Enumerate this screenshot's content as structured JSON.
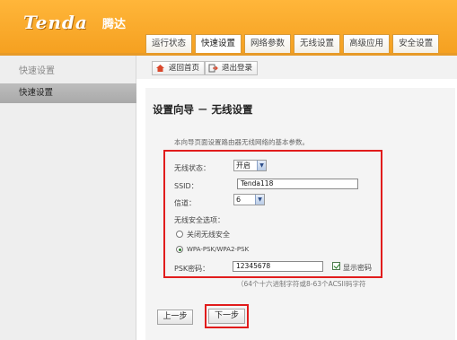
{
  "brand": {
    "logo": "Tenda",
    "logo_cn": "腾达"
  },
  "tabs": [
    {
      "label": "运行状态",
      "active": false
    },
    {
      "label": "快速设置",
      "active": true
    },
    {
      "label": "网络参数",
      "active": false
    },
    {
      "label": "无线设置",
      "active": false
    },
    {
      "label": "高级应用",
      "active": false
    },
    {
      "label": "安全设置",
      "active": false
    }
  ],
  "sidebar": {
    "title": "快速设置",
    "items": [
      {
        "label": "快速设置",
        "selected": true
      }
    ]
  },
  "toolbar": {
    "home_label": "返回首页",
    "logout_label": "退出登录"
  },
  "page": {
    "title": "设置向导 － 无线设置",
    "description": "本向导页面设置路由器无线网络的基本参数。"
  },
  "form": {
    "wireless_status_label": "无线状态：",
    "wireless_status_value": "开启",
    "ssid_label": "SSID：",
    "ssid_value": "Tenda118",
    "channel_label": "信道：",
    "channel_value": "6",
    "security_label": "无线安全选项：",
    "security_off_label": "关闭无线安全",
    "security_wpa_label": "WPA-PSK/WPA2-PSK",
    "psk_label": "PSK密码：",
    "psk_value": "12345678",
    "show_password_label": "显示密码",
    "hint": "（64个十六进制字符或8-63个ACSII码字符"
  },
  "buttons": {
    "prev_label": "上一步",
    "next_label": "下一步"
  },
  "colors": {
    "header": "#f5a020",
    "highlight": "#e11c1c"
  }
}
